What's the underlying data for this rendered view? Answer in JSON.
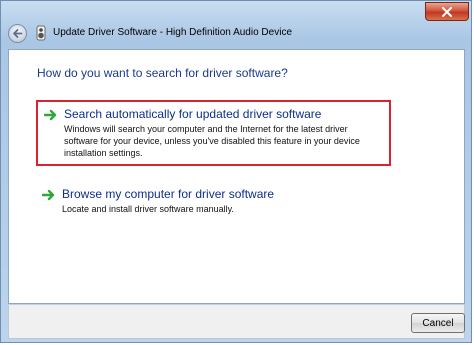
{
  "window": {
    "title": "Update Driver Software - High Definition Audio Device"
  },
  "icons": {
    "close": "close-icon",
    "back": "back-arrow-icon",
    "device": "audio-device-icon",
    "option_arrow": "green-arrow-icon"
  },
  "colors": {
    "heading": "#1a3a8c",
    "option_title": "#0d2f8a",
    "selection_border": "#d8242f",
    "close_button": "#c9442a",
    "arrow_green": "#2fa83a"
  },
  "main": {
    "heading": "How do you want to search for driver software?",
    "options": [
      {
        "title": "Search automatically for updated driver software",
        "description": "Windows will search your computer and the Internet for the latest driver software for your device, unless you've disabled this feature in your device installation settings."
      },
      {
        "title": "Browse my computer for driver software",
        "description": "Locate and install driver software manually."
      }
    ]
  },
  "footer": {
    "cancel_label": "Cancel"
  }
}
